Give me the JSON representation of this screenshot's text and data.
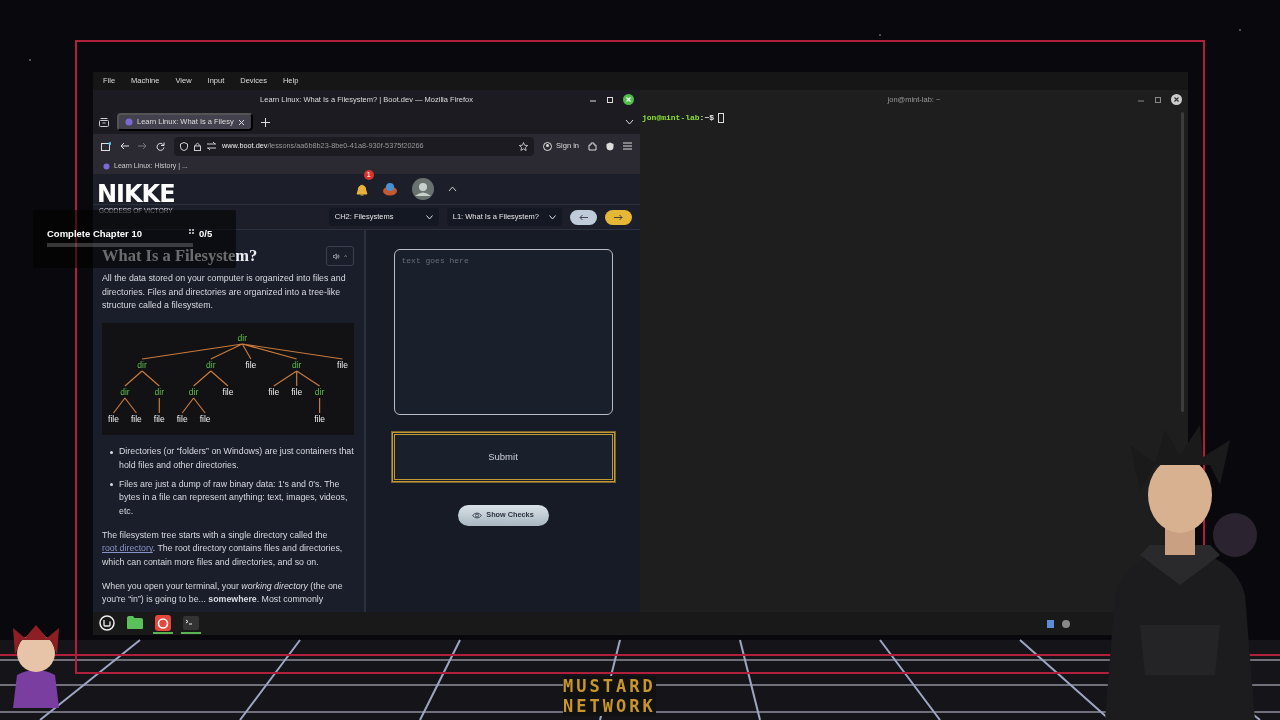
{
  "vm_menu": [
    "File",
    "Machine",
    "View",
    "Input",
    "Devices",
    "Help"
  ],
  "browser": {
    "title": "Learn Linux: What Is a Filesystem? | Boot.dev — Mozilla Firefox",
    "tabs": [
      {
        "label": "Learn Linux: What Is a Filesy",
        "selected": true
      }
    ],
    "url_host": "www.boot.dev",
    "url_path": "/lessons/aa6b8b23-8be0-41a8-930f-5375f20266",
    "sign_in": "Sign in",
    "bookmarks": [
      "Learn Linux: History | ..."
    ]
  },
  "site": {
    "notification_count": "1",
    "chapter_select": "CH2: Filesystems",
    "lesson_select": "L1: What Is a Filesystem?",
    "lesson_title": "What Is a Filesystem?",
    "content": [
      {
        "kind": "paragraph",
        "text": "All the data stored on your computer is organized into files and directories. Files and directories are organized into a tree-like structure called a filesystem."
      },
      {
        "kind": "diagram",
        "root": {
          "kind": "dir",
          "label": "dir",
          "children": [
            {
              "kind": "dir",
              "label": "dir",
              "children": [
                {
                  "kind": "dir",
                  "label": "dir",
                  "children": [
                    {
                      "kind": "file",
                      "label": "file"
                    },
                    {
                      "kind": "file",
                      "label": "file"
                    }
                  ]
                },
                {
                  "kind": "dir",
                  "label": "dir",
                  "children": [
                    {
                      "kind": "file",
                      "label": "file"
                    }
                  ]
                }
              ]
            },
            {
              "kind": "dir",
              "label": "dir",
              "children": [
                {
                  "kind": "dir",
                  "label": "dir",
                  "children": [
                    {
                      "kind": "file",
                      "label": "file"
                    },
                    {
                      "kind": "file",
                      "label": "file"
                    }
                  ]
                },
                {
                  "kind": "file",
                  "label": "file"
                }
              ]
            },
            {
              "kind": "file",
              "label": "file"
            },
            {
              "kind": "dir",
              "label": "dir",
              "children": [
                {
                  "kind": "file",
                  "label": "file"
                },
                {
                  "kind": "file",
                  "label": "file"
                },
                {
                  "kind": "dir",
                  "label": "dir",
                  "children": [
                    {
                      "kind": "file",
                      "label": "file"
                    }
                  ]
                }
              ]
            },
            {
              "kind": "file",
              "label": "file"
            }
          ]
        }
      },
      {
        "kind": "bullets",
        "items": [
          "Directories (or “folders” on Windows) are just containers that hold files and other directories.",
          "Files are just a dump of raw binary data: 1's and 0's. The bytes in a file can represent anything: text, images, videos, etc."
        ]
      },
      {
        "kind": "link_paragraph",
        "before": "The filesystem tree starts with a single directory called the ",
        "link": "root directory",
        "after": ". The root directory contains files and directories, which can contain more files and directories, and so on."
      },
      {
        "kind": "paragraph",
        "text": "When you open your terminal, your *working directory* (the one you're “in”) is going to be... **somewhere**. Most commonly"
      }
    ],
    "answer_placeholder": "text goes here",
    "submit": "Submit",
    "show_checks": "Show Checks"
  },
  "terminal": {
    "title": "jon@mint-lab: ~",
    "prompt_user": "jon@mint-lab",
    "prompt_path": ":~$"
  },
  "overlay": {
    "logo": "NIKKE",
    "logo_subtitle": "GODDESS OF VICTORY",
    "challenge": "Complete Chapter 10",
    "progress": "0/5",
    "level": 0,
    "brand_lines": [
      "MUSTARD",
      "NETWORK"
    ]
  }
}
